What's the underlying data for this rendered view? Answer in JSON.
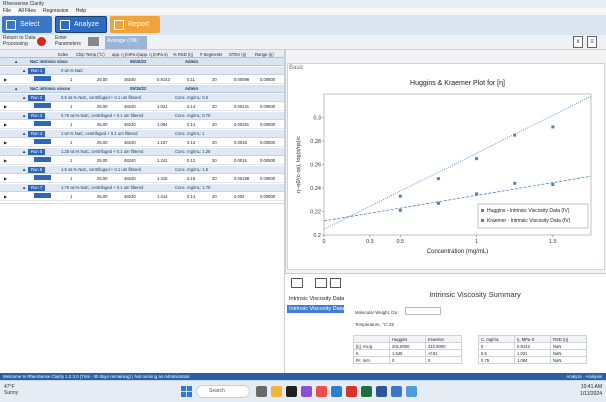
{
  "window_title": "Rheosense Clarity",
  "menu": [
    "File",
    "All Files",
    "Regression",
    "Help"
  ],
  "ribbon": {
    "select": "Select",
    "analyze": "Analyze",
    "report": "Report"
  },
  "toolbar": {
    "return": "Return to Data\nProcessing",
    "enter": "Enter\nParameters",
    "average": "Average"
  },
  "grid_columns": [
    "Index",
    "Chip Temp (°C)",
    "app. η (mPa·s)",
    "app. η (mPa·s)",
    "% RSD (η)",
    "# Segments",
    "STDV (η)",
    "Range (η)"
  ],
  "grid_rows": [
    {
      "kind": "group",
      "text": "NaC intrinsic visco",
      "date": "05/15/22",
      "user": "Admin"
    },
    {
      "kind": "run",
      "text": "Run 1",
      "desc": "0 wt.% NaC"
    },
    {
      "kind": "data",
      "index": "1",
      "temp": "25.00",
      "v1": "48240",
      "v2": "0.9143",
      "rsd": "0.11",
      "seg": "20",
      "stdv": "0.00098",
      "range": "0.00600"
    },
    {
      "kind": "group",
      "text": "NaC intrinsic viscos",
      "date": "05/15/22",
      "user": "Admin"
    },
    {
      "kind": "run",
      "text": "Run 2",
      "desc": "0.5 wt.% NaC, centrifuged + 0.1 um filtered",
      "conc": "Conc. mg/mL: 0.5"
    },
    {
      "kind": "data",
      "index": "1",
      "temp": "25.00",
      "v1": "48240",
      "v2": "1.021",
      "rsd": "0.14",
      "seg": "20",
      "stdv": "0.00141",
      "range": "0.00500"
    },
    {
      "kind": "run",
      "text": "Run 3",
      "desc": "0.75 wt.% NaC, centrifuged + 0.1 um filtered",
      "conc": "Conc. mg/mL: 0.75"
    },
    {
      "kind": "data",
      "index": "1",
      "temp": "25.00",
      "v1": "48240",
      "v2": "1.084",
      "rsd": "0.14",
      "seg": "20",
      "stdv": "0.00151",
      "range": "0.00500"
    },
    {
      "kind": "run",
      "text": "Run 4",
      "desc": "1 wt.% NaC, centrifuged + 0.1 um filtered",
      "conc": "Conc. mg/mL: 1"
    },
    {
      "kind": "data",
      "index": "1",
      "temp": "25.00",
      "v1": "48240",
      "v2": "1.157",
      "rsd": "0.13",
      "seg": "20",
      "stdv": "0.0015",
      "range": "0.00500"
    },
    {
      "kind": "run",
      "text": "Run 5",
      "desc": "1.25 wt.% NaC, centrifuged + 0.1 um filtered",
      "conc": "Conc. mg/mL: 1.25"
    },
    {
      "kind": "data",
      "index": "1",
      "temp": "25.00",
      "v1": "48240",
      "v2": "1.241",
      "rsd": "0.12",
      "seg": "20",
      "stdv": "0.0015",
      "range": "0.00500"
    },
    {
      "kind": "run",
      "text": "Run 6",
      "desc": "1.5 wt.% NaC, centrifuged + 0.1 um filtered",
      "conc": "Conc. mg/mL: 1.5"
    },
    {
      "kind": "data",
      "index": "1",
      "temp": "25.00",
      "v1": "48240",
      "v2": "1.315",
      "rsd": "0.16",
      "seg": "20",
      "stdv": "0.00198",
      "range": "0.00600"
    },
    {
      "kind": "run",
      "text": "Run 7",
      "desc": "1.75 wt.% NaC, centrifuged + 0.1 um filtered",
      "conc": "Conc. mg/mL: 1.75"
    },
    {
      "kind": "data",
      "index": "1",
      "temp": "25.00",
      "v1": "48240",
      "v2": "1.414",
      "rsd": "0.14",
      "seg": "20",
      "stdv": "0.002",
      "range": "0.00600"
    }
  ],
  "basic_tab": "Basic",
  "chart_data": {
    "type": "scatter",
    "title": "Huggins & Kraemer Plot for [η]",
    "xlabel": "Concentration (mg/mL)",
    "ylabel": "η−η0/(c·ηs), log(η/ηs)/c",
    "xlim": [
      0,
      1.75
    ],
    "ylim": [
      0.2,
      0.32
    ],
    "xticks": [
      0,
      0.3,
      0.5,
      1,
      1.5
    ],
    "xtick_labels": [
      "0",
      "0.3",
      "0.5",
      "1",
      "1.5"
    ],
    "yticks": [
      0.2,
      0.22,
      0.24,
      0.26,
      0.28,
      0.3
    ],
    "ytick_labels": [
      "0.2",
      "0.22",
      "0.24",
      "0.26",
      "0.28",
      "0.3"
    ],
    "series": [
      {
        "name": "Huggins - Intrinsic Viscosity Data (IV)",
        "color": "#4f81bd",
        "x": [
          0.5,
          0.75,
          1.0,
          1.25,
          1.5
        ],
        "y": [
          0.233,
          0.248,
          0.265,
          0.285,
          0.292
        ],
        "fit": [
          [
            0,
            0.205
          ],
          [
            1.75,
            0.318
          ]
        ]
      },
      {
        "name": "Kraemer - Intrinsic Viscosity Data (IV)",
        "color": "#4f81bd",
        "x": [
          0.5,
          0.75,
          1.0,
          1.25,
          1.5
        ],
        "y": [
          0.221,
          0.227,
          0.235,
          0.244,
          0.243
        ],
        "fit": [
          [
            0,
            0.212
          ],
          [
            1.75,
            0.25
          ]
        ]
      }
    ],
    "legend_position": "bottom-right"
  },
  "bottom": {
    "nav": [
      "Intrinsic Viscosity Data",
      "Intrinsic Viscosity Data"
    ],
    "summary_title": "Intrinsic Viscosity Summary",
    "mw_label": "Molecular Weight, Da :",
    "temp_label": "Temperature, °C:",
    "temp_value": "25",
    "left_table": {
      "headers": [
        "",
        "Huggins",
        "Kraemer"
      ],
      "rows": [
        [
          "[η], mL/g",
          "201.8000",
          "210.8000"
        ],
        [
          "K",
          "1.545",
          "-0.51"
        ],
        [
          "R², mm",
          "0",
          "0"
        ]
      ]
    },
    "right_table": {
      "headers": [
        "C, mg/mL",
        "η, MPa·S",
        "RSD (η)"
      ],
      "rows": [
        [
          "0",
          "0.9143",
          "NaN"
        ],
        [
          "0.5",
          "1.021",
          "NaN"
        ],
        [
          "0.75",
          "1.084",
          "NaN"
        ]
      ]
    }
  },
  "statusbar": {
    "left": "Welcome to RheoSense Clarity 1.2.3.0 (Trial - 30 days remaining) | Not running as Administrator",
    "right": "Analyze · Analysis"
  },
  "taskbar": {
    "temp": "47°F",
    "weather": "Sunny",
    "search": "Search",
    "time": "10:41 AM",
    "date": "1/11/2024"
  }
}
